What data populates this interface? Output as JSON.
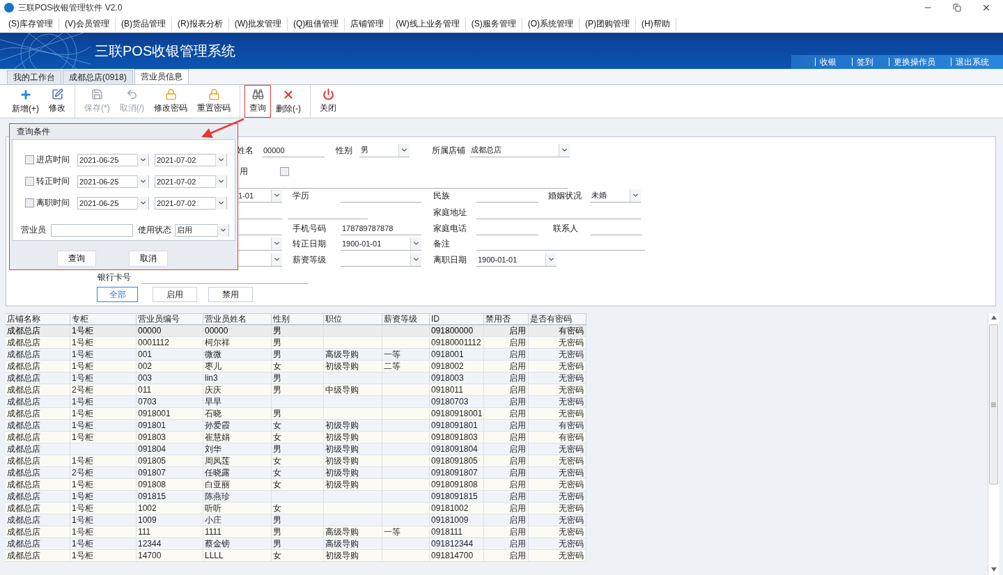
{
  "window": {
    "title": "三联POS收银管理软件 V2.0"
  },
  "menu": [
    "(S)库存管理",
    "(V)会员管理",
    "(B)货品管理",
    "(R)报表分析",
    "(W)批发管理",
    "(Q)租借管理",
    "店铺管理",
    "(W)线上业务管理",
    "(S)服务管理",
    "(O)系统管理",
    "(P)团购管理",
    "(H)帮助"
  ],
  "banner": {
    "title": "三联POS收银管理系统",
    "links": [
      "收银",
      "签到",
      "更换操作员",
      "退出系统"
    ]
  },
  "tabs": [
    {
      "label": "我的工作台",
      "selected": false
    },
    {
      "label": "成都总店(0918)",
      "selected": false
    },
    {
      "label": "营业员信息",
      "selected": true
    }
  ],
  "toolbar": [
    [
      {
        "label": "新增(+)",
        "disabled": false,
        "highlighted": false
      },
      {
        "label": "修改",
        "disabled": false,
        "highlighted": false
      }
    ],
    [
      {
        "label": "保存(*)",
        "disabled": true,
        "highlighted": false
      },
      {
        "label": "取消(/)",
        "disabled": true,
        "highlighted": false
      },
      {
        "label": "修改密码",
        "disabled": false,
        "highlighted": false
      },
      {
        "label": "重置密码",
        "disabled": false,
        "highlighted": false
      }
    ],
    [
      {
        "label": "查询",
        "disabled": false,
        "highlighted": true
      },
      {
        "label": "删除(-)",
        "disabled": false,
        "highlighted": false
      }
    ],
    [
      {
        "label": "关闭",
        "disabled": false,
        "highlighted": false
      }
    ]
  ],
  "form": {
    "rows": [
      {
        "fields": [
          {
            "kind": "text",
            "label": "姓名",
            "value": "00000"
          },
          {
            "kind": "combo",
            "label": "性别",
            "value": "男"
          },
          {
            "kind": "combo",
            "label": "所属店铺",
            "value": "成都总店"
          }
        ]
      },
      {
        "fields": [
          {
            "kind": "checkbox",
            "label": "用",
            "checked": false
          }
        ]
      },
      {
        "fields": [
          {
            "kind": "text"
          }
        ]
      },
      {
        "fields": [
          {
            "kind": "combo",
            "value": "1-01"
          },
          {
            "kind": "text",
            "label": "学历"
          },
          {
            "kind": "text",
            "label": "民族"
          },
          {
            "kind": "combo",
            "label": "婚姻状况",
            "value": "未婚"
          }
        ]
      },
      {
        "fields": [
          {
            "kind": "text"
          },
          {
            "kind": "text"
          },
          {
            "kind": "text",
            "label": "家庭地址"
          }
        ]
      },
      {
        "fields": [
          {
            "kind": "text"
          },
          {
            "kind": "text",
            "label": "手机号码",
            "value": "178789787878"
          },
          {
            "kind": "text",
            "label": "家庭电话"
          },
          {
            "kind": "text",
            "label": "联系人"
          }
        ]
      },
      {
        "fields": [
          {
            "kind": "combo"
          },
          {
            "kind": "combo",
            "label": "转正日期",
            "value": "1900-01-01"
          },
          {
            "kind": "text",
            "label": "备注"
          }
        ]
      },
      {
        "fields": [
          {
            "kind": "combo"
          },
          {
            "kind": "combo",
            "label": "薪资等级"
          },
          {
            "kind": "combo",
            "label": "离职日期",
            "value": "1900-01-01"
          }
        ]
      },
      {
        "fields": [
          {
            "kind": "text",
            "label": "银行卡号"
          }
        ]
      }
    ],
    "filter_buttons": [
      {
        "label": "全部",
        "selected": true
      },
      {
        "label": "启用",
        "selected": false
      },
      {
        "label": "禁用",
        "selected": false
      }
    ]
  },
  "query_dialog": {
    "title": "查询条件",
    "date_rows": [
      {
        "label": "进店时间",
        "checked": false,
        "from": "2021-06-25",
        "to": "2021-07-02"
      },
      {
        "label": "转正时间",
        "checked": false,
        "from": "2021-06-25",
        "to": "2021-07-02"
      },
      {
        "label": "离职时间",
        "checked": false,
        "from": "2021-06-25",
        "to": "2021-07-02"
      }
    ],
    "staff_label": "营业员",
    "status_label": "使用状态",
    "status_value": "启用",
    "buttons": [
      "查询",
      "取消"
    ]
  },
  "table": {
    "columns": [
      "店铺名称",
      "专柜",
      "营业员编号",
      "营业员姓名",
      "性别",
      "职位",
      "薪资等级",
      "ID",
      "禁用否",
      "是否有密码"
    ],
    "rows": [
      {
        "selected": true,
        "cells": [
          "成都总店",
          "1号柜",
          "00000",
          "00000",
          "男",
          null,
          null,
          "091800000",
          "启用",
          "有密码"
        ]
      },
      {
        "selected": false,
        "cells": [
          "成都总店",
          "1号柜",
          "0001112",
          "柯尔祥",
          "男",
          null,
          null,
          "09180001112",
          "启用",
          "无密码"
        ]
      },
      {
        "selected": false,
        "cells": [
          "成都总店",
          "1号柜",
          "001",
          "微微",
          "男",
          "高级导购",
          "一等",
          "0918001",
          "启用",
          "无密码"
        ]
      },
      {
        "selected": false,
        "cells": [
          "成都总店",
          "1号柜",
          "002",
          "枣儿",
          "女",
          "初级导购",
          "二等",
          "0918002",
          "启用",
          "无密码"
        ]
      },
      {
        "selected": false,
        "cells": [
          "成都总店",
          "1号柜",
          "003",
          "lin3",
          "男",
          null,
          null,
          "0918003",
          "启用",
          "无密码"
        ]
      },
      {
        "selected": false,
        "cells": [
          "成都总店",
          "2号柜",
          "011",
          "庆庆",
          "男",
          "中级导购",
          null,
          "0918011",
          "启用",
          "无密码"
        ]
      },
      {
        "selected": false,
        "cells": [
          "成都总店",
          "1号柜",
          "0703",
          "早早",
          null,
          null,
          null,
          "09180703",
          "启用",
          "无密码"
        ]
      },
      {
        "selected": false,
        "cells": [
          "成都总店",
          "1号柜",
          "0918001",
          "石晓",
          "男",
          null,
          null,
          "09180918001",
          "启用",
          "无密码"
        ]
      },
      {
        "selected": false,
        "cells": [
          "成都总店",
          "1号柜",
          "091801",
          "孙爱霞",
          "女",
          "初级导购",
          null,
          "0918091801",
          "启用",
          "有密码"
        ]
      },
      {
        "selected": false,
        "cells": [
          "成都总店",
          "1号柜",
          "091803",
          "崔慧娟",
          "女",
          "初级导购",
          null,
          "0918091803",
          "启用",
          "有密码"
        ]
      },
      {
        "selected": false,
        "cells": [
          "成都总店",
          null,
          "091804",
          "刘华",
          "男",
          "初级导购",
          null,
          "0918091804",
          "启用",
          "无密码"
        ]
      },
      {
        "selected": false,
        "cells": [
          "成都总店",
          "1号柜",
          "091805",
          "周凤莲",
          "女",
          "初级导购",
          null,
          "0918091805",
          "启用",
          "无密码"
        ]
      },
      {
        "selected": false,
        "cells": [
          "成都总店",
          "2号柜",
          "091807",
          "任晓露",
          "女",
          "初级导购",
          null,
          "0918091807",
          "启用",
          "无密码"
        ]
      },
      {
        "selected": false,
        "cells": [
          "成都总店",
          "1号柜",
          "091808",
          "白亚丽",
          "女",
          "初级导购",
          null,
          "0918091808",
          "启用",
          "无密码"
        ]
      },
      {
        "selected": false,
        "cells": [
          "成都总店",
          "1号柜",
          "091815",
          "陈燕珍",
          null,
          null,
          null,
          "0918091815",
          "启用",
          "无密码"
        ]
      },
      {
        "selected": false,
        "cells": [
          "成都总店",
          "1号柜",
          "1002",
          "听听",
          "女",
          null,
          null,
          "09181002",
          "启用",
          "无密码"
        ]
      },
      {
        "selected": false,
        "cells": [
          "成都总店",
          "1号柜",
          "1009",
          "小庄",
          "男",
          null,
          null,
          "09181009",
          "启用",
          "无密码"
        ]
      },
      {
        "selected": false,
        "cells": [
          "成都总店",
          "1号柜",
          "111",
          "1111",
          "男",
          "高级导购",
          "一等",
          "0918111",
          "启用",
          "无密码"
        ]
      },
      {
        "selected": false,
        "cells": [
          "成都总店",
          "1号柜",
          "12344",
          "蔡金镑",
          "男",
          "高级导购",
          null,
          "091812344",
          "启用",
          "无密码"
        ]
      },
      {
        "selected": false,
        "cells": [
          "成都总店",
          "1号柜",
          "14700",
          "LLLL",
          "女",
          "初级导购",
          null,
          "091814700",
          "启用",
          "无密码"
        ]
      }
    ]
  }
}
